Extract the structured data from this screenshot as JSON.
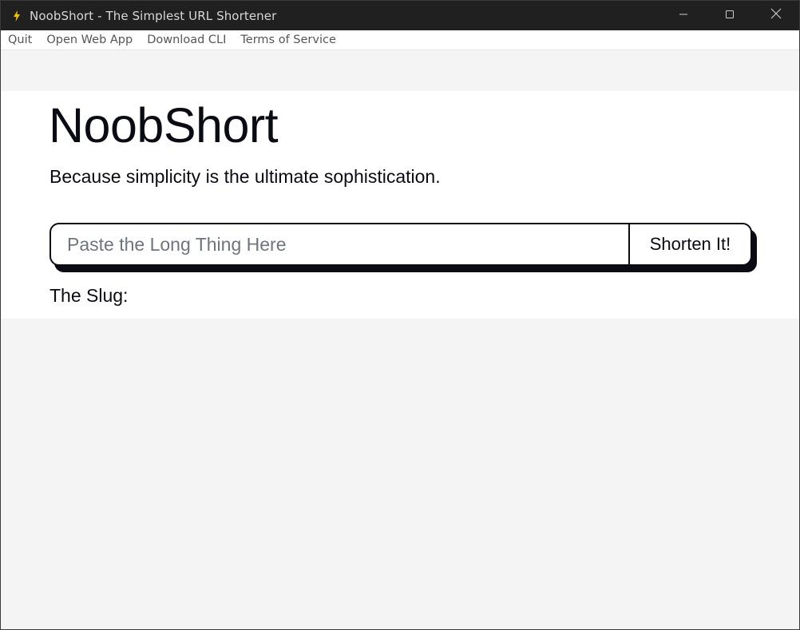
{
  "window": {
    "title": "NoobShort - The Simplest URL Shortener",
    "app_icon": "lightning-bolt-icon",
    "controls": [
      "minimize-icon",
      "maximize-icon",
      "close-icon"
    ]
  },
  "menu": {
    "items": [
      {
        "label": "Quit"
      },
      {
        "label": "Open Web App"
      },
      {
        "label": "Download CLI"
      },
      {
        "label": "Terms of Service"
      }
    ]
  },
  "main": {
    "heading": "NoobShort",
    "tagline": "Because simplicity is the ultimate sophistication.",
    "url_input": {
      "value": "",
      "placeholder": "Paste the Long Thing Here"
    },
    "shorten_button": "Shorten It!",
    "slug_label": "The Slug:"
  },
  "colors": {
    "titlebar": "#202020",
    "text": "#0b0b14",
    "placeholder": "#6f757c",
    "page_background": "#f4f4f4",
    "card_background": "#ffffff",
    "icon_accent": "#f2c200"
  }
}
